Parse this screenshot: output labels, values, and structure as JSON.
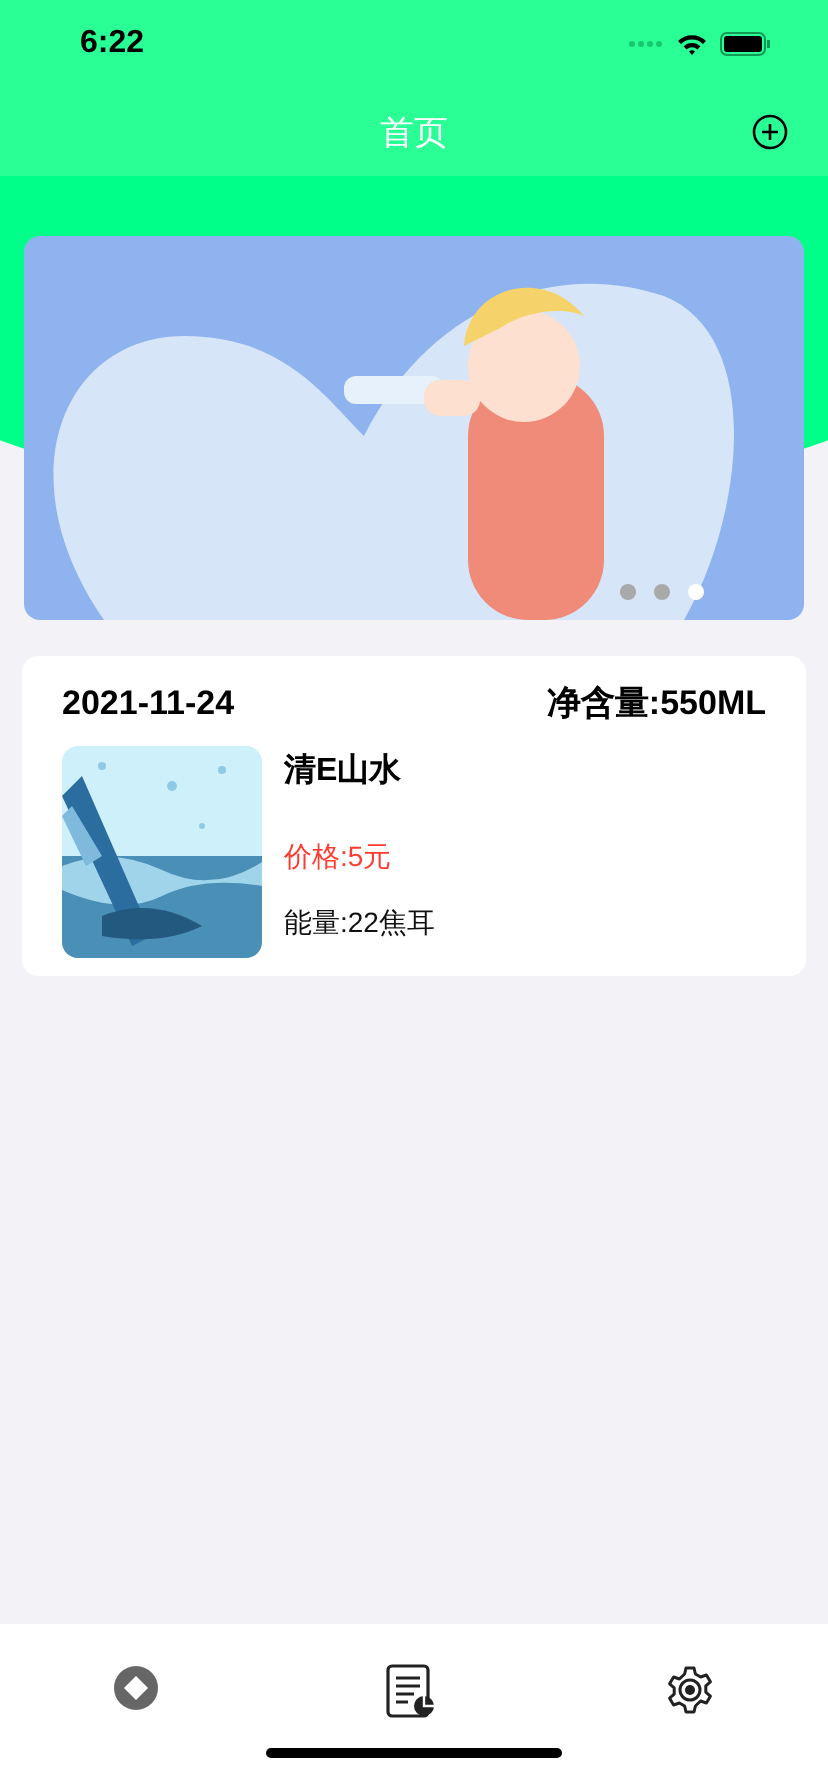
{
  "status_bar": {
    "time": "6:22"
  },
  "nav_bar": {
    "title": "首页"
  },
  "banner": {
    "kind": "picture",
    "dots": [
      {
        "selected": false
      },
      {
        "selected": false
      },
      {
        "selected": true
      }
    ]
  },
  "products": [
    {
      "date": "2021-11-24",
      "net_content": "净含量:550ML",
      "name": "清E山水",
      "price": "价格:5元",
      "energy": "能量:22焦耳"
    }
  ],
  "tab_bar": {
    "tabs": [
      {
        "kind": "home"
      },
      {
        "kind": "report"
      },
      {
        "kind": "settings"
      }
    ]
  }
}
